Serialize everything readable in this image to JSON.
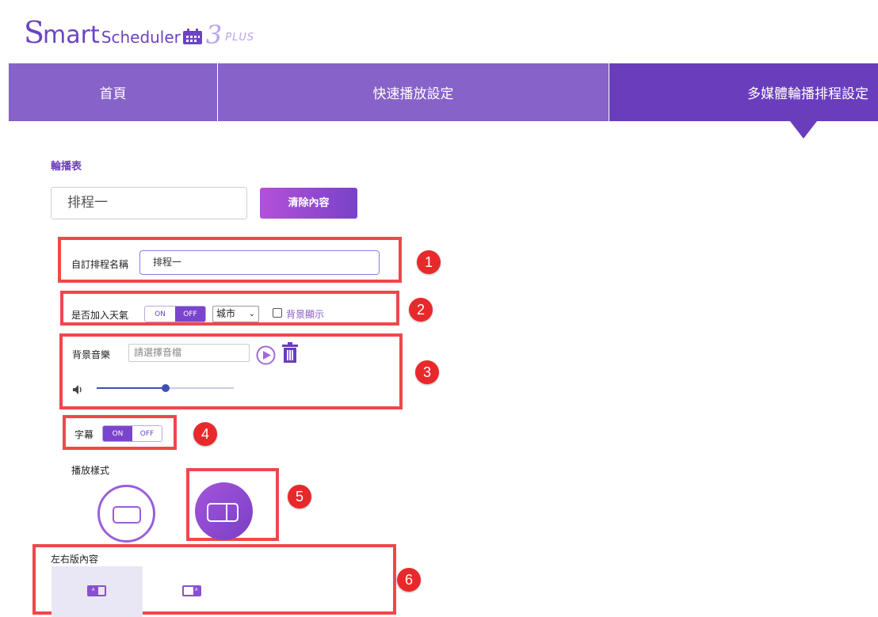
{
  "logo": {
    "s": "S",
    "mart": "mart",
    "scheduler": "Scheduler",
    "version": "3",
    "edition": "PLUS"
  },
  "nav": {
    "items": [
      {
        "label": "首頁"
      },
      {
        "label": "快速播放設定"
      },
      {
        "label": "多媒體輪播排程設定"
      }
    ],
    "active_index": 2
  },
  "playlist": {
    "section_title": "輪播表",
    "schedule_value": "排程一",
    "clear_button": "清除內容"
  },
  "settings": {
    "custom_name_label": "自訂排程名稱",
    "custom_name_value": "排程一",
    "weather_label": "是否加入天氣",
    "weather_on": "ON",
    "weather_off": "OFF",
    "weather_state": "OFF",
    "city_value": "城市",
    "bg_display_label": "背景顯示",
    "bg_display_checked": false,
    "music_label": "背景音樂",
    "music_placeholder": "請選擇音檔",
    "volume": 0.5,
    "subtitle_label": "字幕",
    "subtitle_on": "ON",
    "subtitle_off": "OFF",
    "subtitle_state": "ON",
    "play_style_label": "播放樣式",
    "selected_style": "left-right",
    "lr_content_label": "左右版內容",
    "lr_icon_text": "A"
  },
  "annotations": [
    "1",
    "2",
    "3",
    "4",
    "5",
    "6"
  ],
  "colors": {
    "nav_bg": "#8762c8",
    "nav_active": "#6a3dbd",
    "accent": "#7a45cc",
    "annotation_red": "#f0474c"
  }
}
